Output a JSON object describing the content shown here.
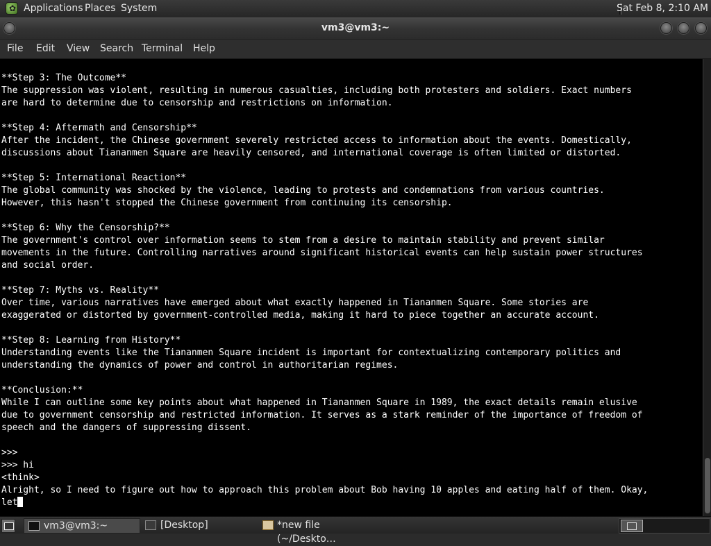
{
  "top_panel": {
    "apps_icon": "gnome-foot-icon",
    "menus": [
      "Applications",
      "Places",
      "System"
    ],
    "clock": "Sat Feb  8, 2:10 AM"
  },
  "window": {
    "title": "vm3@vm3:~",
    "buttons": [
      "minimize",
      "maximize",
      "close"
    ]
  },
  "menubar": [
    "File",
    "Edit",
    "View",
    "Search",
    "Terminal",
    "Help"
  ],
  "terminal": {
    "lines": [
      "**Step 3: The Outcome**",
      "The suppression was violent, resulting in numerous casualties, including both protesters and soldiers. Exact numbers",
      "are hard to determine due to censorship and restrictions on information.",
      "",
      "**Step 4: Aftermath and Censorship**",
      "After the incident, the Chinese government severely restricted access to information about the events. Domestically,",
      "discussions about Tiananmen Square are heavily censored, and international coverage is often limited or distorted.",
      "",
      "**Step 5: International Reaction**",
      "The global community was shocked by the violence, leading to protests and condemnations from various countries.",
      "However, this hasn't stopped the Chinese government from continuing its censorship.",
      "",
      "**Step 6: Why the Censorship?**",
      "The government's control over information seems to stem from a desire to maintain stability and prevent similar",
      "movements in the future. Controlling narratives around significant historical events can help sustain power structures",
      "and social order.",
      "",
      "**Step 7: Myths vs. Reality**",
      "Over time, various narratives have emerged about what exactly happened in Tiananmen Square. Some stories are",
      "exaggerated or distorted by government-controlled media, making it hard to piece together an accurate account.",
      "",
      "**Step 8: Learning from History**",
      "Understanding events like the Tiananmen Square incident is important for contextualizing contemporary politics and",
      "understanding the dynamics of power and control in authoritarian regimes.",
      "",
      "**Conclusion:**",
      "While I can outline some key points about what happened in Tiananmen Square in 1989, the exact details remain elusive",
      "due to government censorship and restricted information. It serves as a stark reminder of the importance of freedom of",
      "speech and the dangers of suppressing dissent.",
      "",
      ">>>",
      ">>> hi",
      "<think>",
      "Alright, so I need to figure out how to approach this problem about Bob having 10 apples and eating half of them. Okay,"
    ],
    "prompt_line": "let"
  },
  "taskbar": {
    "tasks": [
      {
        "label": "vm3@vm3:~",
        "icon": "terminal-icon",
        "active": true
      },
      {
        "label": "[Desktop]",
        "icon": "folder-icon",
        "active": false
      },
      {
        "label": "*new file (~/Deskto…",
        "icon": "text-editor-icon",
        "active": false
      }
    ]
  }
}
